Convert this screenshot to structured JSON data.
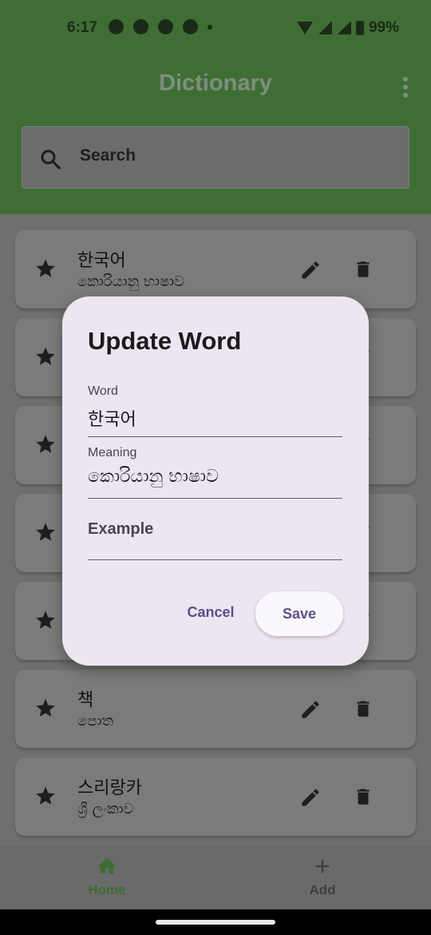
{
  "status_bar": {
    "time": "6:17",
    "battery": "99%",
    "icons": [
      "whatsapp-icon",
      "facebook-icon",
      "telegram-icon",
      "sync-icon",
      "dot-icon",
      "wifi-icon",
      "signal-icon",
      "signal-icon",
      "battery-icon"
    ]
  },
  "app_bar": {
    "title": "Dictionary",
    "menu_icon": "more-vert-icon",
    "color": "#3f6e35"
  },
  "search": {
    "placeholder": "Search",
    "icon": "search-icon"
  },
  "entries": [
    {
      "word": "한국어",
      "meaning": "කොරියානු භාෂාව"
    },
    {
      "word": "",
      "meaning": ""
    },
    {
      "word": "",
      "meaning": ""
    },
    {
      "word": "",
      "meaning": ""
    },
    {
      "word": "",
      "meaning": ""
    },
    {
      "word": "책",
      "meaning": "පොත"
    },
    {
      "word": "스리랑카",
      "meaning": "ශ්‍රී ලංකාව"
    }
  ],
  "dialog": {
    "title": "Update Word",
    "word_label": "Word",
    "word_value": "한국어",
    "meaning_label": "Meaning",
    "meaning_value": "කොරියානු භාෂාව",
    "example_placeholder": "Example",
    "cancel_label": "Cancel",
    "save_label": "Save"
  },
  "bottom_nav": {
    "items": [
      {
        "label": "Home",
        "icon": "home-icon",
        "active": true
      },
      {
        "label": "Add",
        "icon": "add-icon",
        "active": false
      }
    ]
  }
}
